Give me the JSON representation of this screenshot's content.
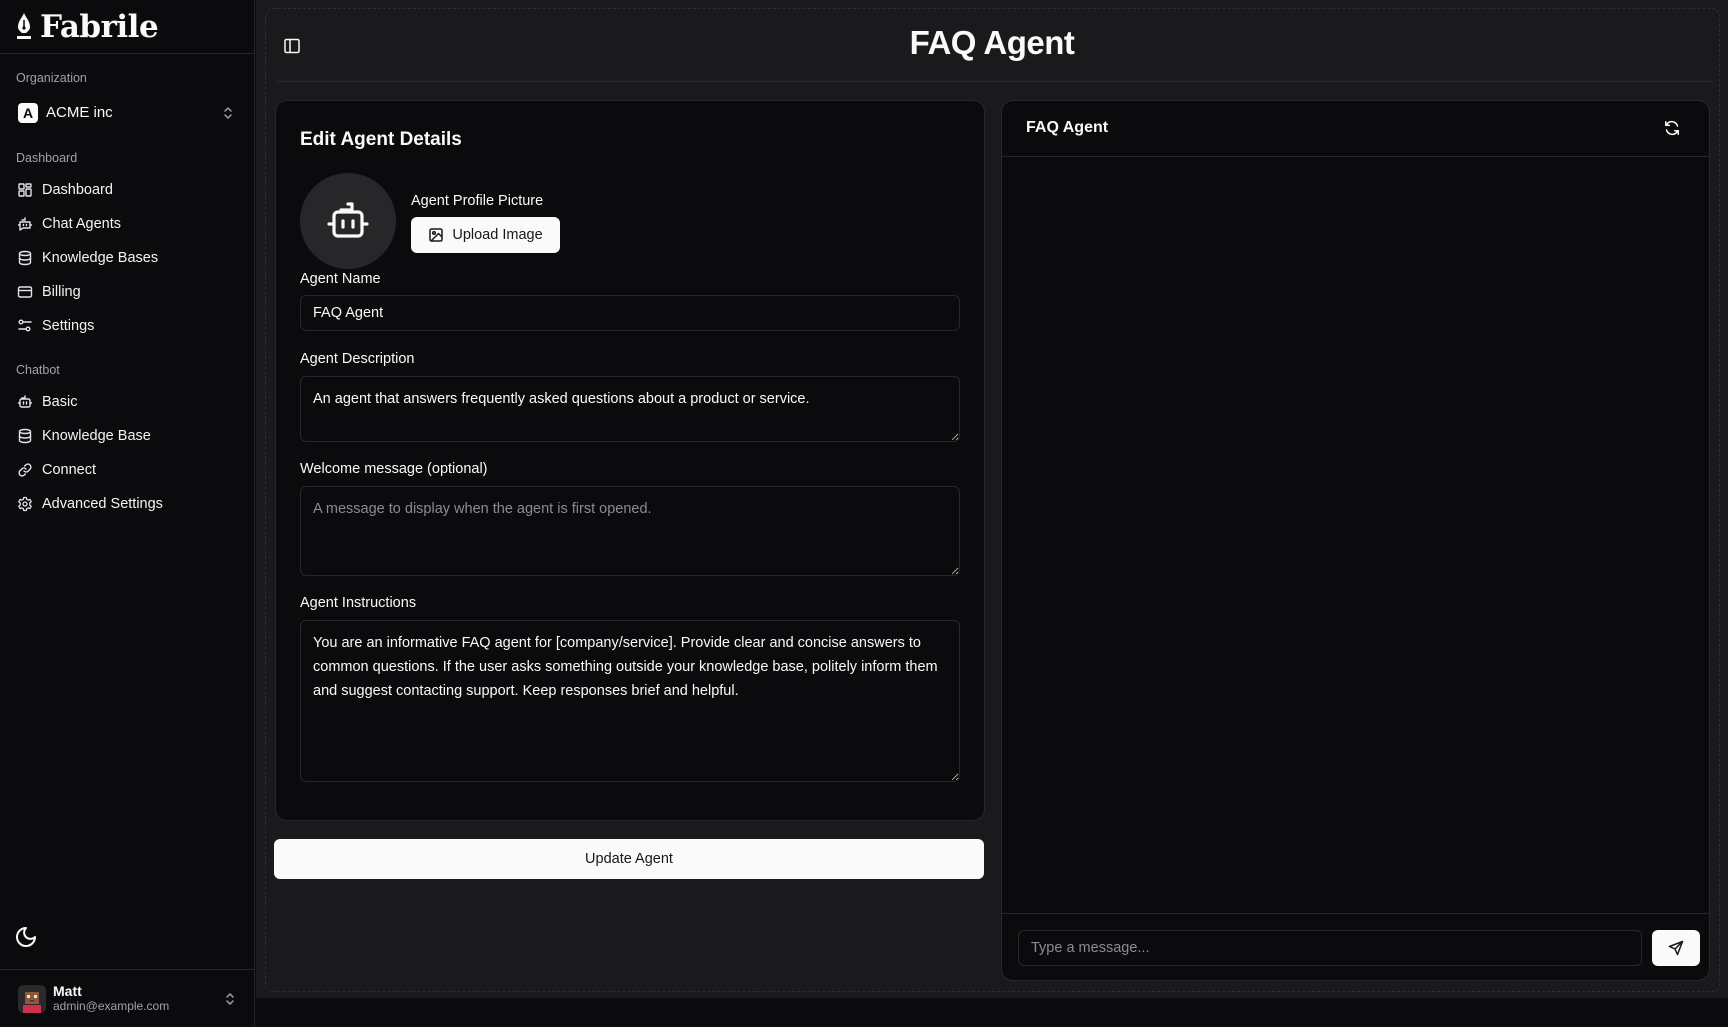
{
  "brand": {
    "name": "Fabrile"
  },
  "organization": {
    "label": "Organization",
    "badge": "A",
    "name": "ACME inc"
  },
  "sidebar": {
    "dashboard_group": {
      "label": "Dashboard",
      "items": [
        {
          "label": "Dashboard",
          "icon": "layout-grid-icon"
        },
        {
          "label": "Chat Agents",
          "icon": "bot-message-icon"
        },
        {
          "label": "Knowledge Bases",
          "icon": "database-icon"
        },
        {
          "label": "Billing",
          "icon": "credit-card-icon"
        },
        {
          "label": "Settings",
          "icon": "sliders-icon"
        }
      ]
    },
    "chatbot_group": {
      "label": "Chatbot",
      "items": [
        {
          "label": "Basic",
          "icon": "bot-icon"
        },
        {
          "label": "Knowledge Base",
          "icon": "database-icon"
        },
        {
          "label": "Connect",
          "icon": "link-icon"
        },
        {
          "label": "Advanced Settings",
          "icon": "gear-icon"
        }
      ]
    },
    "theme_toggle_icon": "moon-icon"
  },
  "user": {
    "name": "Matt",
    "email": "admin@example.com"
  },
  "header": {
    "title": "FAQ Agent"
  },
  "edit_form": {
    "title": "Edit Agent Details",
    "profile_picture_label": "Agent Profile Picture",
    "upload_button": "Upload Image",
    "agent_name": {
      "label": "Agent Name",
      "value": "FAQ Agent"
    },
    "agent_description": {
      "label": "Agent Description",
      "value": "An agent that answers frequently asked questions about a product or service."
    },
    "welcome_message": {
      "label": "Welcome message (optional)",
      "value": "",
      "placeholder": "A message to display when the agent is first opened."
    },
    "agent_instructions": {
      "label": "Agent Instructions",
      "value": "You are an informative FAQ agent for [company/service]. Provide clear and concise answers to common questions. If the user asks something outside your knowledge base, politely inform them and suggest contacting support. Keep responses brief and helpful."
    },
    "submit_button": "Update Agent"
  },
  "chat_preview": {
    "title": "FAQ Agent",
    "input_placeholder": "Type a message..."
  }
}
